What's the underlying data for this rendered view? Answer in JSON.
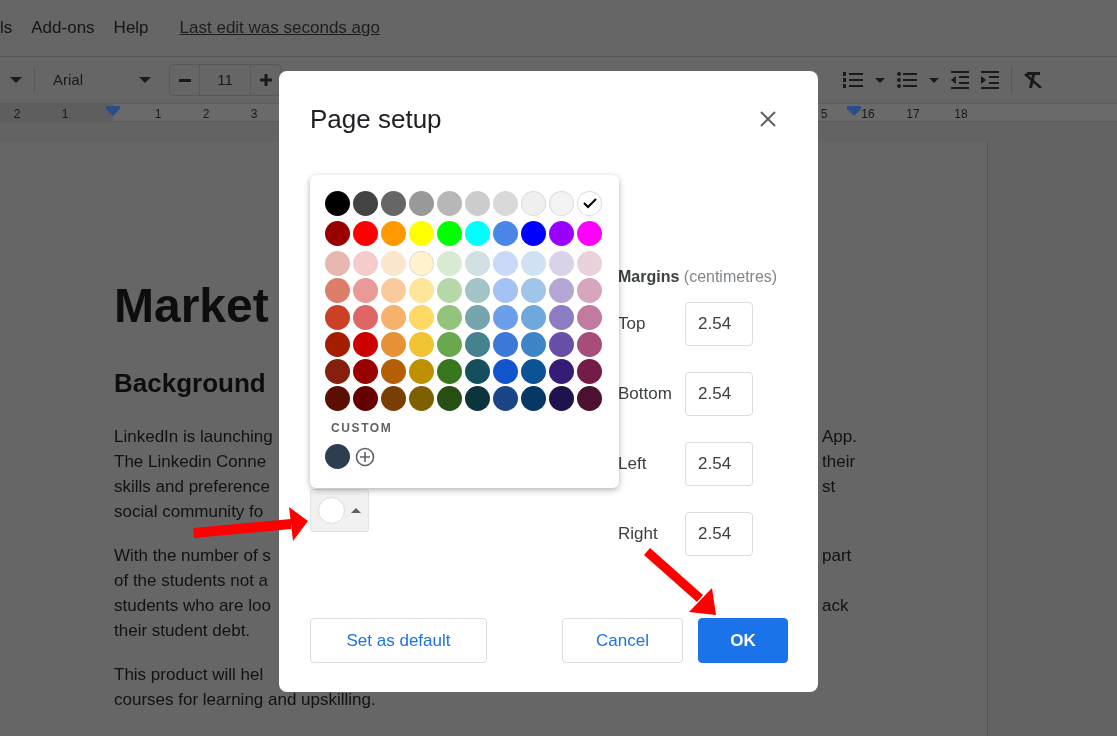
{
  "menu_bar": {
    "items": [
      "ls",
      "Add-ons",
      "Help"
    ],
    "last_edit": "Last edit was seconds ago"
  },
  "toolbar": {
    "font": "Arial",
    "font_size": "11"
  },
  "ruler": {
    "left_labels": [
      "2",
      "1",
      "1",
      "2",
      "3"
    ],
    "right_labels": [
      "5",
      "16",
      "17",
      "18"
    ]
  },
  "document": {
    "title": "Market",
    "heading": "Background",
    "paragraphs": [
      {
        "lines": [
          {
            "left": "LinkedIn is launching",
            "right": "App."
          },
          {
            "left": "The Linkedin Conne",
            "right": "their"
          },
          {
            "left": "skills and preference",
            "right": "st"
          },
          {
            "left": "social community fo"
          }
        ]
      },
      {
        "lines": [
          {
            "left": "With the number of s",
            "right": "part"
          },
          {
            "left": "of the students not a"
          },
          {
            "left": "students who are loo",
            "right": "ack"
          },
          {
            "left": "their student debt."
          }
        ]
      },
      {
        "lines": [
          {
            "left": "This product will hel"
          },
          {
            "left": "courses for learning and upskilling."
          }
        ]
      }
    ]
  },
  "dialog": {
    "title": "Page setup",
    "page_color": {
      "color": "#ffffff"
    },
    "margins": {
      "label": "Margins",
      "unit": "(centimetres)",
      "fields": [
        {
          "label": "Top",
          "value": "2.54"
        },
        {
          "label": "Bottom",
          "value": "2.54"
        },
        {
          "label": "Left",
          "value": "2.54"
        },
        {
          "label": "Right",
          "value": "2.54"
        }
      ]
    },
    "buttons": [
      {
        "label": "Set as default",
        "kind": "outline"
      },
      {
        "label": "Cancel",
        "kind": "outline"
      },
      {
        "label": "OK",
        "kind": "primary"
      }
    ],
    "color_palette": {
      "rows": [
        {
          "swatches": [
            {
              "color": "#000000",
              "selected": false
            },
            {
              "color": "#434343",
              "selected": false
            },
            {
              "color": "#666666",
              "selected": false
            },
            {
              "color": "#999999",
              "selected": false
            },
            {
              "color": "#b7b7b7",
              "selected": false
            },
            {
              "color": "#cccccc",
              "selected": false
            },
            {
              "color": "#d9d9d9",
              "selected": false
            },
            {
              "color": "#efefef",
              "selected": false
            },
            {
              "color": "#f3f3f3",
              "selected": false
            },
            {
              "color": "#ffffff",
              "selected": true
            }
          ]
        },
        {
          "swatches": [
            {
              "color": "#980000",
              "selected": false
            },
            {
              "color": "#ff0000",
              "selected": false
            },
            {
              "color": "#ff9900",
              "selected": false
            },
            {
              "color": "#ffff00",
              "selected": false
            },
            {
              "color": "#00ff00",
              "selected": false
            },
            {
              "color": "#00ffff",
              "selected": false
            },
            {
              "color": "#4a86e8",
              "selected": false
            },
            {
              "color": "#0000ff",
              "selected": false
            },
            {
              "color": "#9900ff",
              "selected": false
            },
            {
              "color": "#ff00ff",
              "selected": false
            }
          ]
        },
        {
          "swatches": [
            {
              "color": "#e6b8af",
              "selected": false
            },
            {
              "color": "#f4cccc",
              "selected": false
            },
            {
              "color": "#fce5cd",
              "selected": false
            },
            {
              "color": "#fff2cc",
              "selected": false
            },
            {
              "color": "#d9ead3",
              "selected": false
            },
            {
              "color": "#d0e0e3",
              "selected": false
            },
            {
              "color": "#c9daf8",
              "selected": false
            },
            {
              "color": "#cfe2f3",
              "selected": false
            },
            {
              "color": "#d9d2e9",
              "selected": false
            },
            {
              "color": "#ead1dc",
              "selected": false
            }
          ]
        },
        {
          "swatches": [
            {
              "color": "#dd7e6b",
              "selected": false
            },
            {
              "color": "#ea9999",
              "selected": false
            },
            {
              "color": "#f9cb9c",
              "selected": false
            },
            {
              "color": "#ffe599",
              "selected": false
            },
            {
              "color": "#b6d7a8",
              "selected": false
            },
            {
              "color": "#a2c4c9",
              "selected": false
            },
            {
              "color": "#a4c2f4",
              "selected": false
            },
            {
              "color": "#9fc5e8",
              "selected": false
            },
            {
              "color": "#b4a7d6",
              "selected": false
            },
            {
              "color": "#d5a6bd",
              "selected": false
            }
          ]
        },
        {
          "swatches": [
            {
              "color": "#cc4125",
              "selected": false
            },
            {
              "color": "#e06666",
              "selected": false
            },
            {
              "color": "#f6b26b",
              "selected": false
            },
            {
              "color": "#ffd966",
              "selected": false
            },
            {
              "color": "#93c47d",
              "selected": false
            },
            {
              "color": "#76a5af",
              "selected": false
            },
            {
              "color": "#6d9eeb",
              "selected": false
            },
            {
              "color": "#6fa8dc",
              "selected": false
            },
            {
              "color": "#8e7cc3",
              "selected": false
            },
            {
              "color": "#c27ba0",
              "selected": false
            }
          ]
        },
        {
          "swatches": [
            {
              "color": "#a61c00",
              "selected": false
            },
            {
              "color": "#cc0000",
              "selected": false
            },
            {
              "color": "#e69138",
              "selected": false
            },
            {
              "color": "#f1c232",
              "selected": false
            },
            {
              "color": "#6aa84f",
              "selected": false
            },
            {
              "color": "#45818e",
              "selected": false
            },
            {
              "color": "#3c78d8",
              "selected": false
            },
            {
              "color": "#3d85c6",
              "selected": false
            },
            {
              "color": "#674ea7",
              "selected": false
            },
            {
              "color": "#a64d79",
              "selected": false
            }
          ]
        },
        {
          "swatches": [
            {
              "color": "#85200c",
              "selected": false
            },
            {
              "color": "#990000",
              "selected": false
            },
            {
              "color": "#b45f06",
              "selected": false
            },
            {
              "color": "#bf9000",
              "selected": false
            },
            {
              "color": "#38761d",
              "selected": false
            },
            {
              "color": "#134f5c",
              "selected": false
            },
            {
              "color": "#1155cc",
              "selected": false
            },
            {
              "color": "#0b5394",
              "selected": false
            },
            {
              "color": "#351c75",
              "selected": false
            },
            {
              "color": "#741b47",
              "selected": false
            }
          ]
        },
        {
          "swatches": [
            {
              "color": "#5b0f00",
              "selected": false
            },
            {
              "color": "#660000",
              "selected": false
            },
            {
              "color": "#783f04",
              "selected": false
            },
            {
              "color": "#7f6000",
              "selected": false
            },
            {
              "color": "#274e13",
              "selected": false
            },
            {
              "color": "#0c343d",
              "selected": false
            },
            {
              "color": "#1c4587",
              "selected": false
            },
            {
              "color": "#073763",
              "selected": false
            },
            {
              "color": "#20124d",
              "selected": false
            },
            {
              "color": "#4c1130",
              "selected": false
            }
          ]
        }
      ],
      "custom_label": "CUSTOM",
      "custom_colors": [
        {
          "color": "#2d3e50"
        }
      ]
    }
  }
}
